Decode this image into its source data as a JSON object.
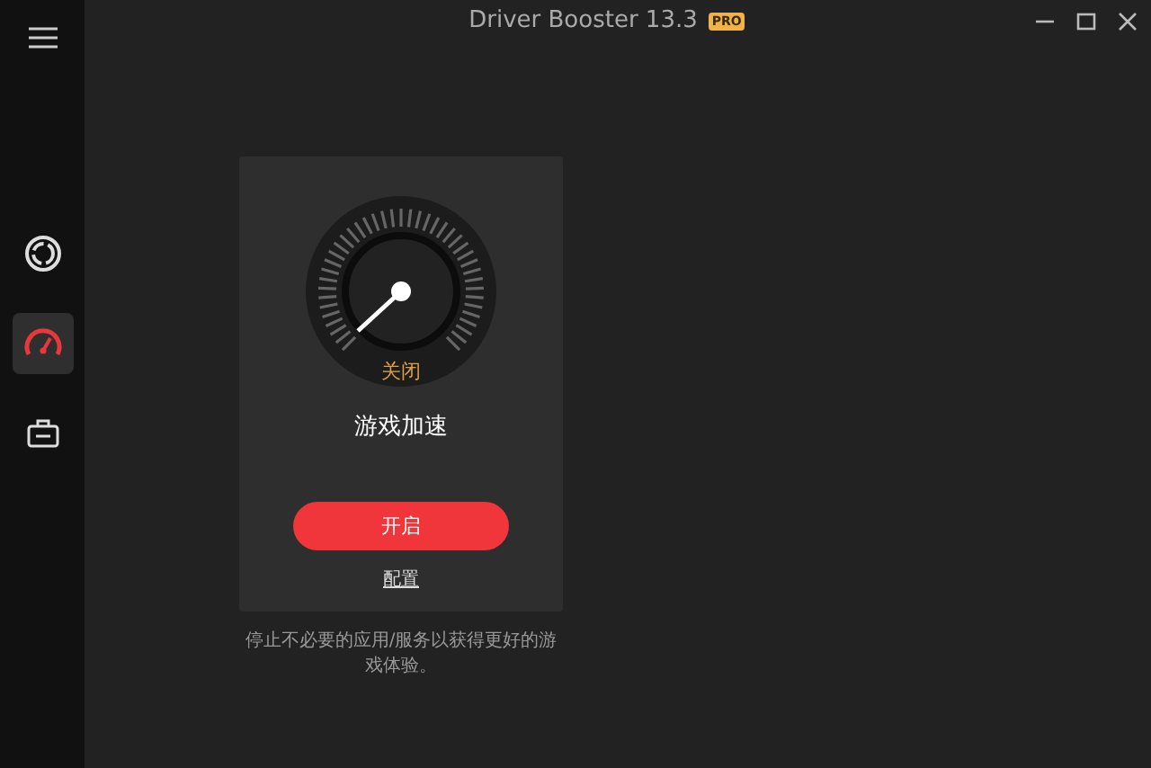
{
  "window": {
    "title": "Driver Booster 13.3",
    "badge": "PRO"
  },
  "sidebar": {
    "items": [
      {
        "kind": "ring",
        "selected": false
      },
      {
        "kind": "gauge",
        "selected": true
      },
      {
        "kind": "toolbox",
        "selected": false
      }
    ]
  },
  "card": {
    "status": "关闭",
    "title": "游戏加速",
    "button": "开启",
    "link": "配置"
  },
  "description": "停止不必要的应用/服务以获得更好的游戏体验。"
}
